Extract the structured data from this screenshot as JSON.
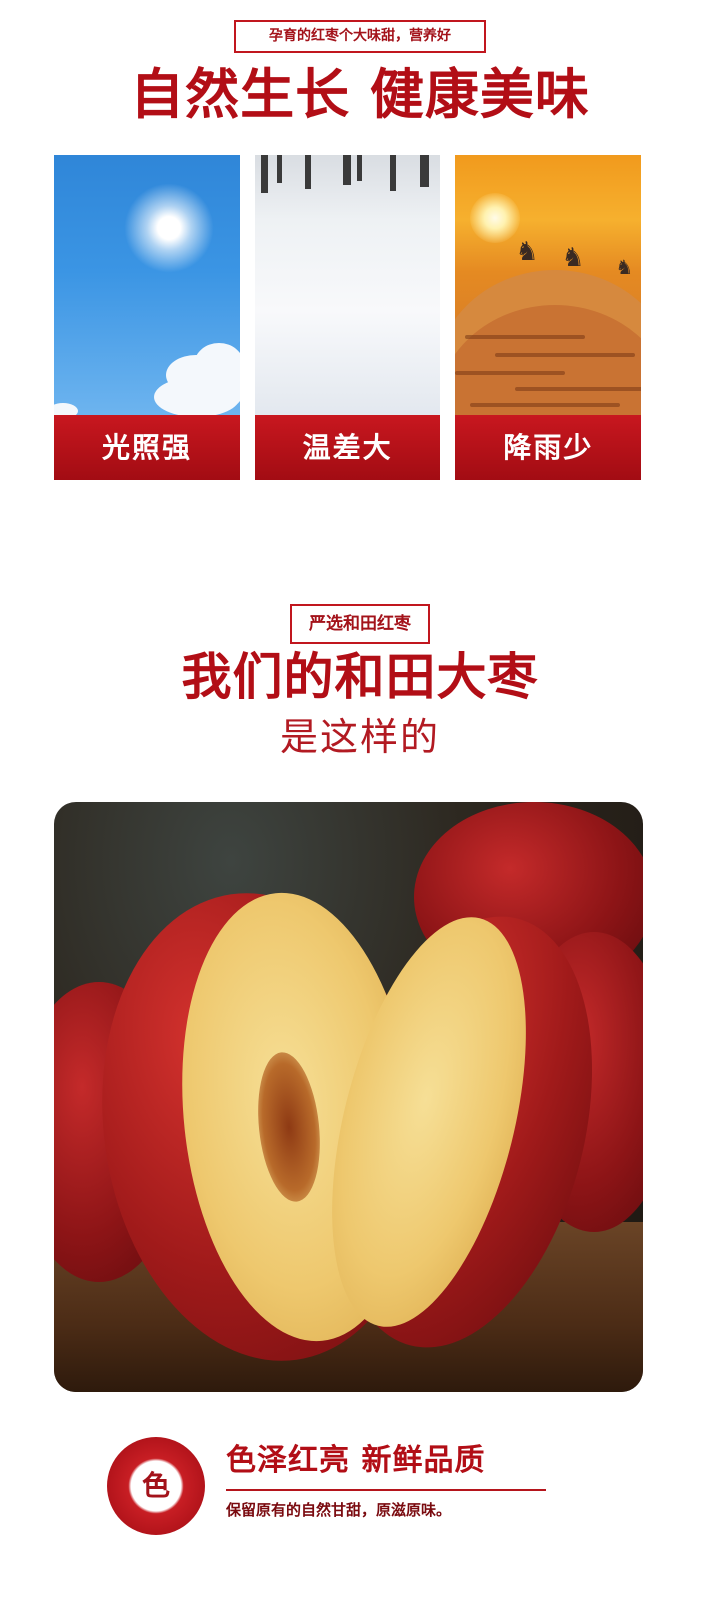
{
  "section1": {
    "tag": "孕育的红枣个大味甜，营养好",
    "title": "自然生长 健康美味",
    "panels": [
      {
        "caption": "光照强",
        "scene": "sunny-sky-image"
      },
      {
        "caption": "温差大",
        "scene": "snow-field-image"
      },
      {
        "caption": "降雨少",
        "scene": "desert-camels-image"
      }
    ]
  },
  "section2": {
    "tag": "严选和田红枣",
    "title": "我们的和田大枣",
    "subtitle": "是这样的",
    "photo": "cut-red-dates-photo"
  },
  "feature": {
    "badge": "色",
    "title": "色泽红亮 新鲜品质",
    "desc": "保留原有的自然甘甜，原滋原味。"
  },
  "colors": {
    "brand_red": "#b20e16",
    "caption_red": "#c8171f"
  }
}
